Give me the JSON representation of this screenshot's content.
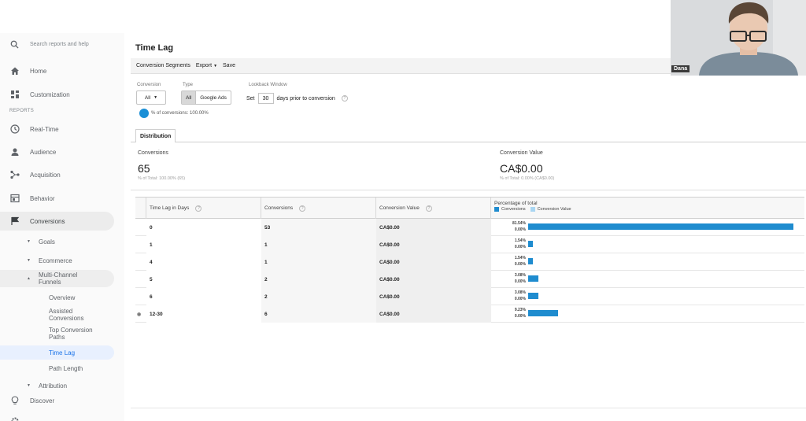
{
  "sidebar": {
    "search_placeholder": "Search reports and help",
    "home": "Home",
    "customization": "Customization",
    "reports_label": "REPORTS",
    "realtime": "Real-Time",
    "audience": "Audience",
    "acquisition": "Acquisition",
    "behavior": "Behavior",
    "conversions": "Conversions",
    "goals": "Goals",
    "ecommerce": "Ecommerce",
    "mcf_line1": "Multi-Channel",
    "mcf_line2": "Funnels",
    "overview": "Overview",
    "assisted_line1": "Assisted",
    "assisted_line2": "Conversions",
    "topconv_line1": "Top Conversion",
    "topconv_line2": "Paths",
    "time_lag": "Time Lag",
    "path_length": "Path Length",
    "attribution": "Attribution",
    "discover": "Discover"
  },
  "header": {
    "title": "Time Lag",
    "conversion_segments": "Conversion Segments",
    "export": "Export",
    "save": "Save"
  },
  "controls": {
    "conversion_label": "Conversion",
    "conversion_value": "All",
    "type_label": "Type",
    "type_all": "All",
    "type_google_ads": "Google Ads",
    "lookback_label": "Lookback Window",
    "set": "Set",
    "days_value": "30",
    "days_text": "days prior to conversion",
    "pct_text": "% of conversions: 100.00%"
  },
  "tab": {
    "distribution": "Distribution"
  },
  "summary": {
    "conversions_label": "Conversions",
    "conversions_value": "65",
    "conversions_sub": "% of Total: 100.00% (65)",
    "value_label": "Conversion Value",
    "value_value": "CA$0.00",
    "value_sub": "% of Total: 0.00% (CA$0.00)"
  },
  "table": {
    "headers": {
      "time_lag": "Time Lag in Days",
      "conversions": "Conversions",
      "value": "Conversion Value",
      "pct": "Percentage of total",
      "legend_conv": "Conversions",
      "legend_value": "Conversion Value"
    },
    "rows": [
      {
        "lag": "0",
        "conversions": "53",
        "value": "CA$0.00",
        "pct": "81.54%",
        "pct_value": "0.00%",
        "share": 81.54
      },
      {
        "lag": "1",
        "conversions": "1",
        "value": "CA$0.00",
        "pct": "1.54%",
        "pct_value": "0.00%",
        "share": 1.54
      },
      {
        "lag": "4",
        "conversions": "1",
        "value": "CA$0.00",
        "pct": "1.54%",
        "pct_value": "0.00%",
        "share": 1.54
      },
      {
        "lag": "5",
        "conversions": "2",
        "value": "CA$0.00",
        "pct": "3.08%",
        "pct_value": "0.00%",
        "share": 3.08
      },
      {
        "lag": "6",
        "conversions": "2",
        "value": "CA$0.00",
        "pct": "3.08%",
        "pct_value": "0.00%",
        "share": 3.08
      },
      {
        "lag": "12-30",
        "conversions": "6",
        "value": "CA$0.00",
        "pct": "9.23%",
        "pct_value": "0.00%",
        "share": 9.23
      }
    ]
  },
  "webcam": {
    "name": "Dana"
  },
  "colors": {
    "bar": "#1f8ccf",
    "legend_value": "#a9d6f2",
    "accent": "#1a73e8"
  }
}
